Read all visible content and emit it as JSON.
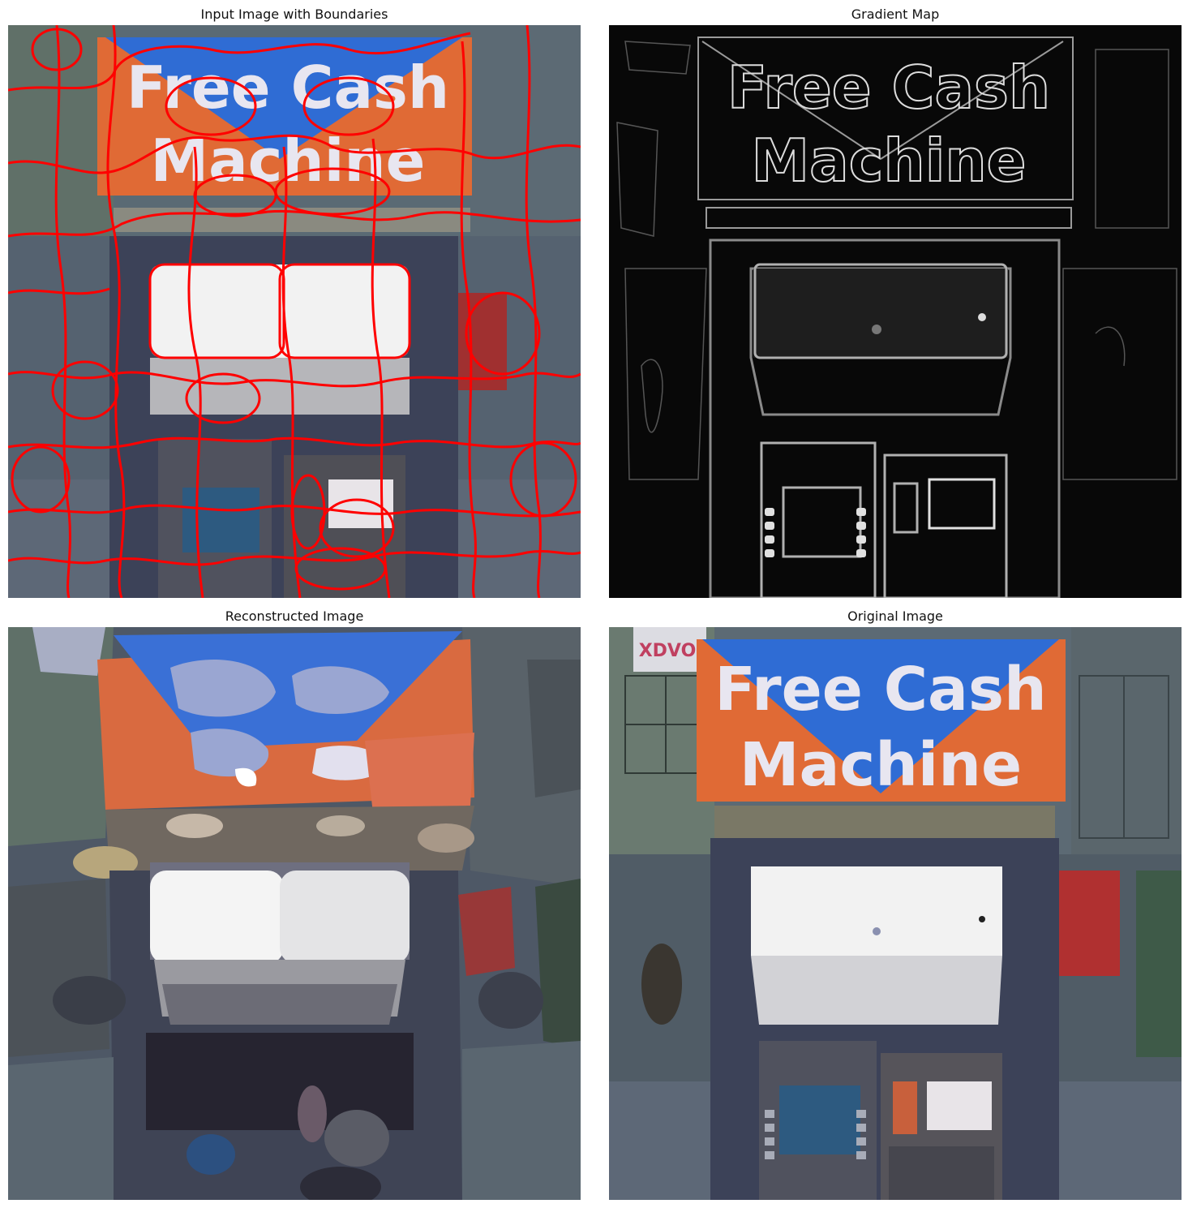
{
  "panels": {
    "boundaries": {
      "title": "Input Image with Boundaries"
    },
    "gradient": {
      "title": "Gradient Map"
    },
    "reconstructed": {
      "title": "Reconstructed Image"
    },
    "original": {
      "title": "Original Image"
    }
  },
  "sign": {
    "line1": "Free Cash",
    "line2": "Machine",
    "logo_text": "XDVO"
  },
  "colors": {
    "sign_orange": "#e06a35",
    "sign_blue": "#2f6cd4",
    "sign_text": "#e8e6f0",
    "boundary_red": "#ff0000",
    "atm_body": "#3c4258",
    "screen_white": "#f2f2f2",
    "background_blue_gray": "#5e6c78"
  }
}
